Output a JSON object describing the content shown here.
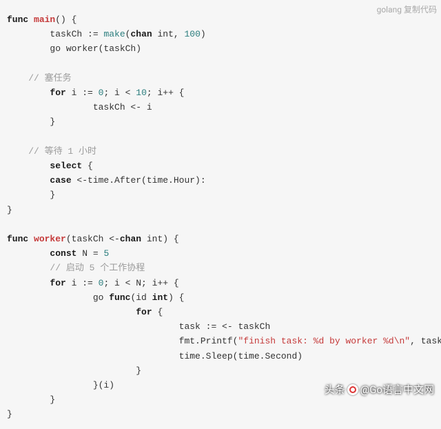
{
  "header": {
    "language_label": "golang",
    "copy_label": "复制代码"
  },
  "code": {
    "t01a": "func",
    "t01b": "main",
    "t01c": "() {",
    "t02a": "        taskCh := ",
    "t02b": "make",
    "t02c": "(",
    "t02d": "chan",
    "t02e": " int, ",
    "t02f": "100",
    "t02g": ")",
    "t03": "        go worker(taskCh)",
    "c1": "    // 塞任务",
    "t05a": "        for",
    "t05b": " i := ",
    "t05c": "0",
    "t05d": "; i < ",
    "t05e": "10",
    "t05f": "; i++ {",
    "t06": "                taskCh <- i",
    "t07": "        }",
    "c2": "    // 等待 1 小时",
    "t09a": "        select",
    "t09b": " {",
    "t10a": "        case",
    "t10b": " <-time.After(time.Hour):",
    "t11": "        }",
    "t12": "}",
    "t14a": "func",
    "t14b": "worker",
    "t14c": "(taskCh <-",
    "t14d": "chan",
    "t14e": " int) {",
    "t15a": "        const",
    "t15b": " N = ",
    "t15c": "5",
    "c3": "        // 启动 5 个工作协程",
    "t17a": "        for",
    "t17b": " i := ",
    "t17c": "0",
    "t17d": "; i < N; i++ {",
    "t18a": "                go ",
    "t18b": "func",
    "t18c": "(id ",
    "t18d": "int",
    "t18e": ") {",
    "t19a": "                        for",
    "t19b": " {",
    "t20": "                                task := <- taskCh",
    "t21a": "                                fmt.Printf(",
    "t21b": "\"finish task: %d by worker %d\\n\"",
    "t21c": ", task, id)",
    "t22": "                                time.Sleep(time.Second)",
    "t23": "                        }",
    "t24": "                }(i)",
    "t25": "        }",
    "t26": "}"
  },
  "watermark": {
    "label1": "头条",
    "label2": "@Go语言中文网"
  }
}
